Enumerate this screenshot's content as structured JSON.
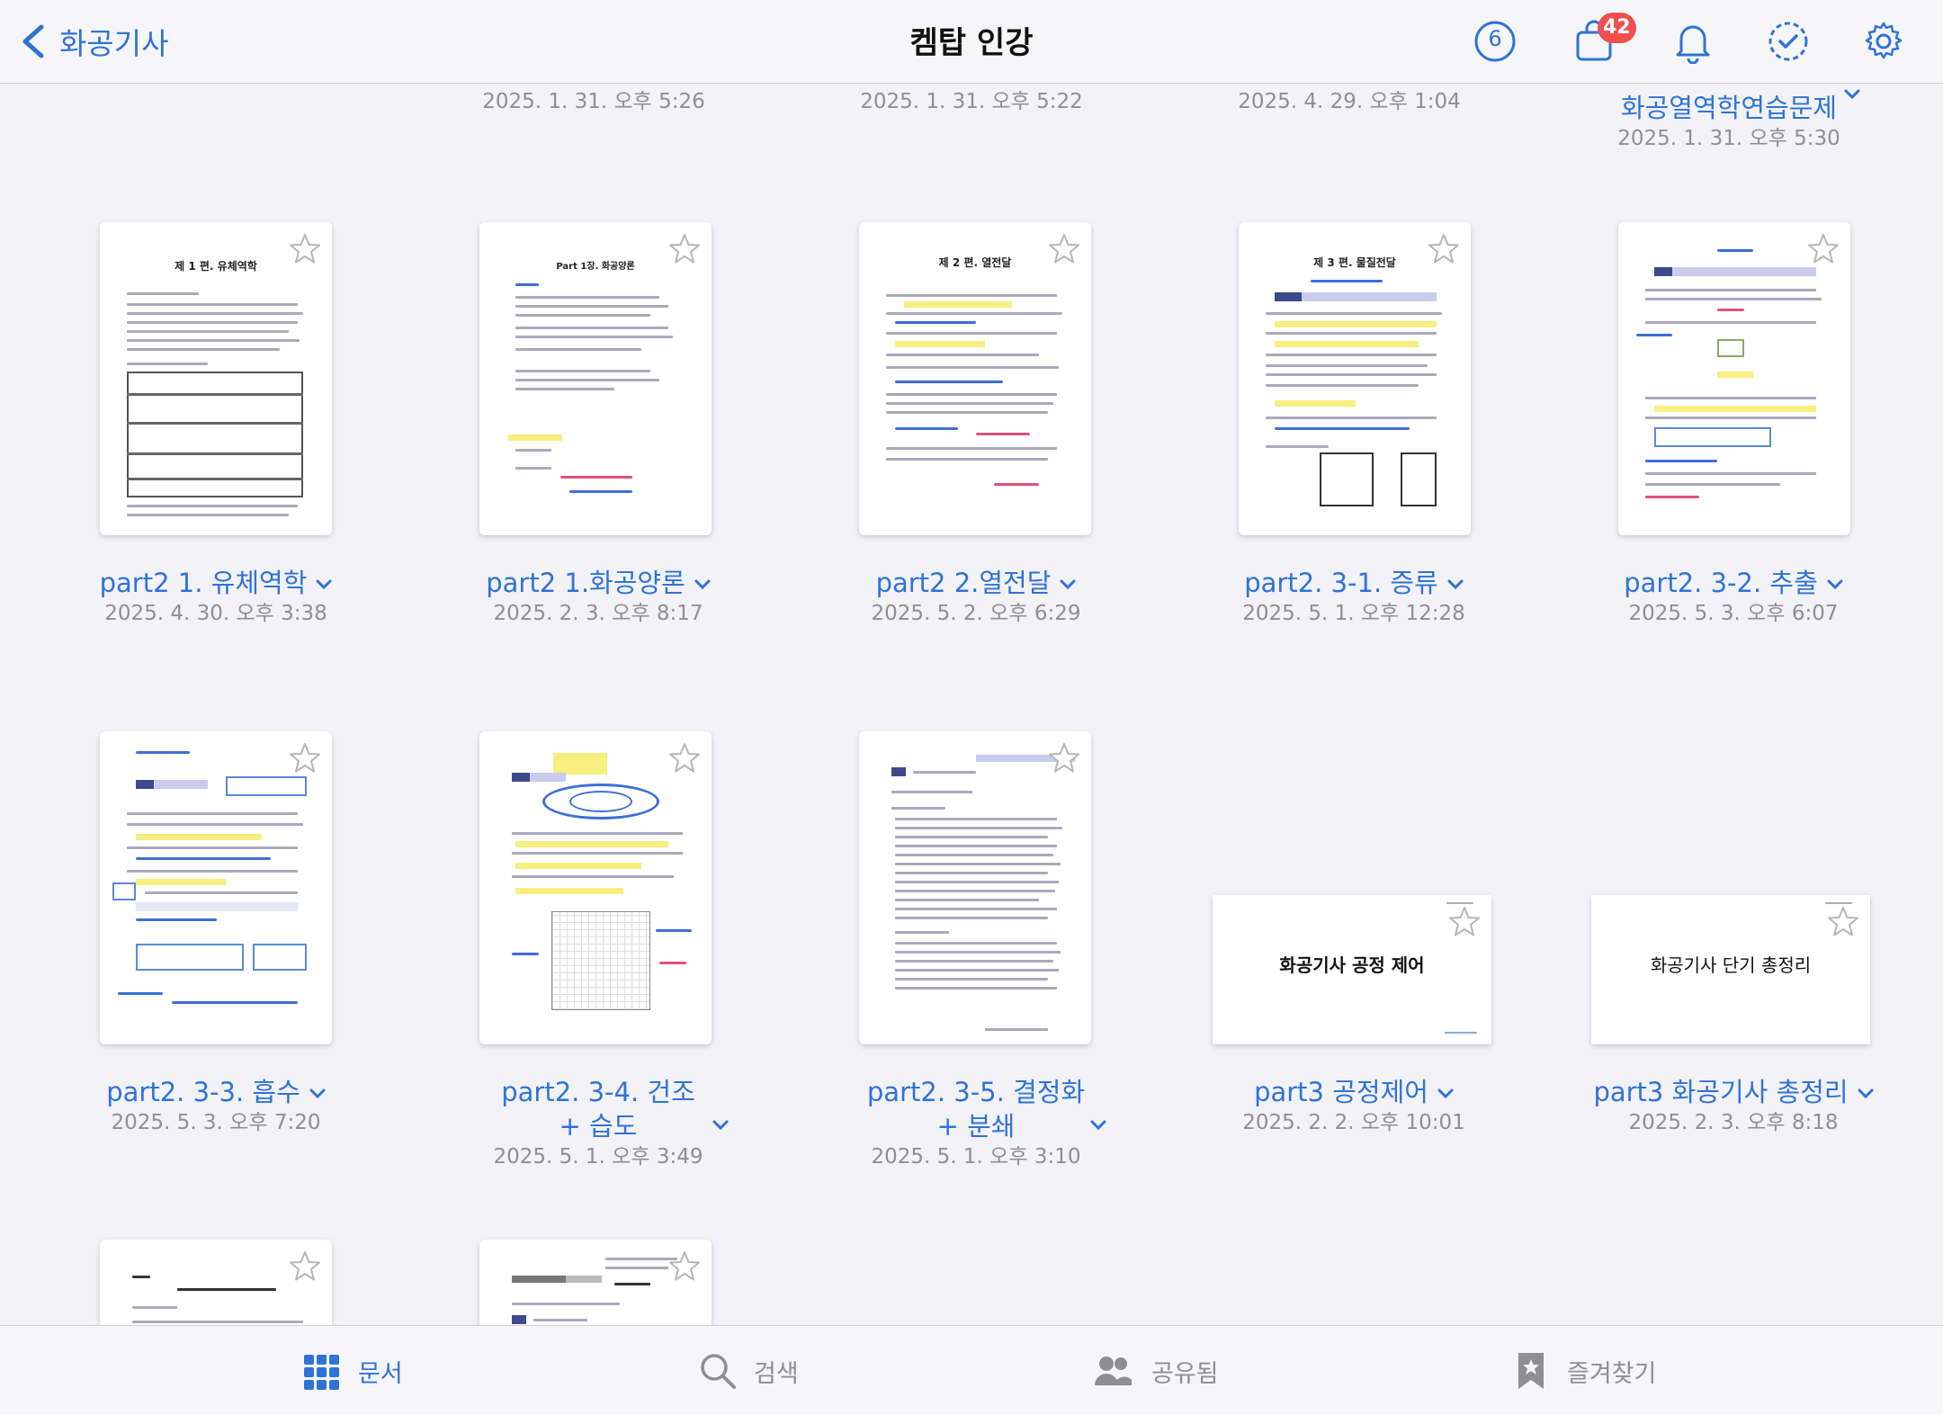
{
  "nav": {
    "back_label": "화공기사",
    "title": "켐탑 인강",
    "counter": "6",
    "bag_badge": "42"
  },
  "top_row": [
    {
      "title": "",
      "date": "2025. 1. 31. 오후 5:26"
    },
    {
      "title": "",
      "date": "2025. 1. 31. 오후 5:22"
    },
    {
      "title": "",
      "date": "2025. 4. 29. 오후 1:04"
    },
    {
      "title": "화공열역학연습문제",
      "date": "2025. 1. 31. 오후 5:30"
    }
  ],
  "row1": [
    {
      "title": "part2 1. 유체역학",
      "date": "2025. 4. 30. 오후 3:38",
      "page_heading": "제 1 편. 유체역학"
    },
    {
      "title": "part2 1.화공양론",
      "date": "2025. 2. 3. 오후 8:17",
      "page_heading": "Part 1장. 화공양론"
    },
    {
      "title": "part2 2.열전달",
      "date": "2025. 5. 2. 오후 6:29",
      "page_heading": "제 2 편. 열전달"
    },
    {
      "title": "part2. 3-1. 증류",
      "date": "2025. 5. 1. 오후 12:28",
      "page_heading": "제 3 편. 물질전달"
    },
    {
      "title": "part2. 3-2. 추출",
      "date": "2025. 5. 3. 오후 6:07",
      "page_heading": ""
    }
  ],
  "row2": [
    {
      "title": "part2. 3-3. 흡수",
      "date": "2025. 5. 3. 오후 7:20"
    },
    {
      "title_line1": "part2. 3-4. 건조",
      "title_line2": "+ 습도",
      "date": "2025. 5. 1. 오후 3:49"
    },
    {
      "title_line1": "part2. 3-5. 결정화",
      "title_line2": "+ 분쇄",
      "date": "2025. 5. 1. 오후 3:10"
    },
    {
      "title": "part3 공정제어",
      "date": "2025. 2. 2. 오후 10:01",
      "slide_text": "화공기사 공정 제어"
    },
    {
      "title": "part3 화공기사 총정리",
      "date": "2025. 2. 3. 오후 8:18",
      "slide_text": "화공기사 단기 총정리"
    }
  ],
  "tabs": [
    {
      "label": "문서"
    },
    {
      "label": "검색"
    },
    {
      "label": "공유됨"
    },
    {
      "label": "즐겨찾기"
    }
  ],
  "colors": {
    "accent": "#2f73d8",
    "badge": "#f04f4f",
    "date_gray": "#8e8e93"
  },
  "icons": {
    "back": "chevron-left-icon",
    "counter": "circle-number-icon",
    "bag": "shopping-bag-icon",
    "bell": "bell-icon",
    "check": "dashed-check-circle-icon",
    "settings": "gear-icon",
    "star": "star-outline-icon"
  }
}
